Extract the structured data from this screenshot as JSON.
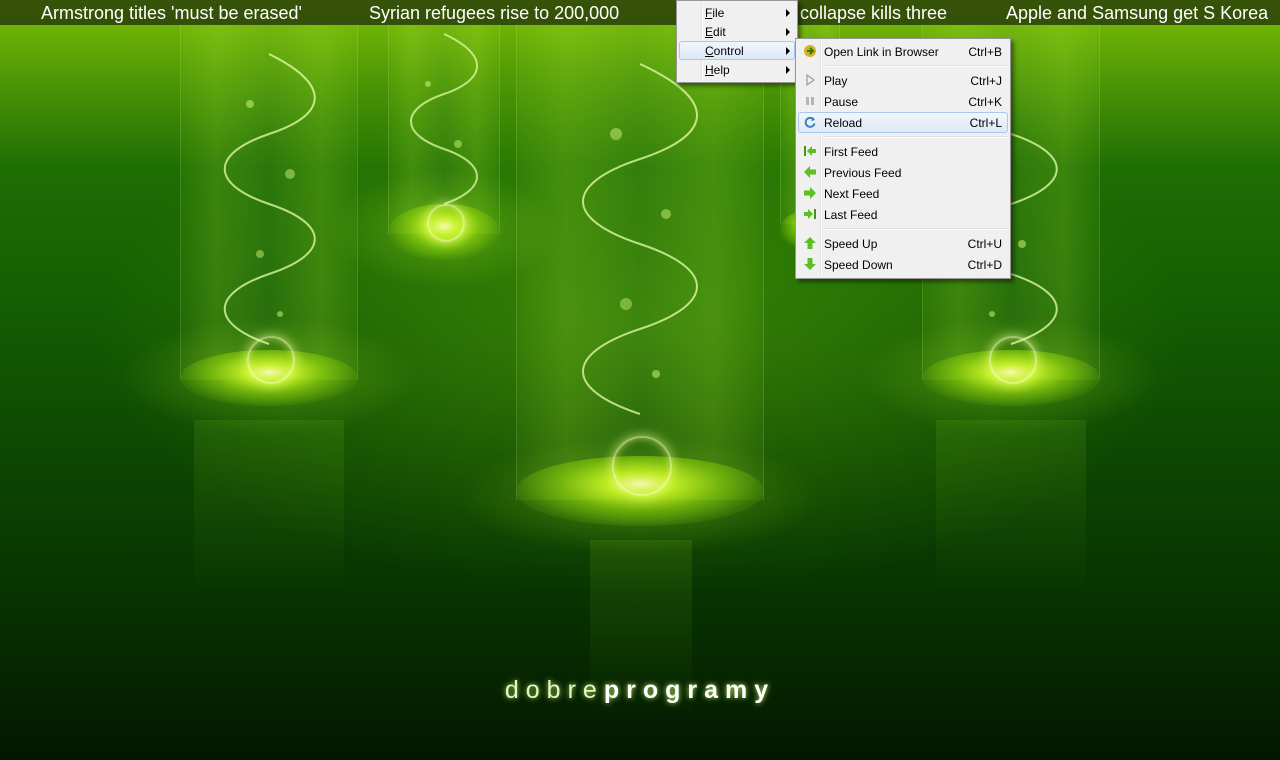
{
  "ticker": {
    "items": [
      "Armstrong titles 'must be erased'",
      "Syrian refugees rise to 200,000",
      "collapse kills three",
      "Apple and Samsung get S Korea"
    ]
  },
  "menu": {
    "items": [
      {
        "label": "File",
        "mnemonic": "F"
      },
      {
        "label": "Edit",
        "mnemonic": "E"
      },
      {
        "label": "Control",
        "mnemonic": "C",
        "selected": true
      },
      {
        "label": "Help",
        "mnemonic": "H"
      }
    ]
  },
  "control_submenu": {
    "items": [
      {
        "label": "Open Link in Browser",
        "shortcut": "Ctrl+B",
        "icon": "open-link-icon"
      },
      {
        "label": "Play",
        "shortcut": "Ctrl+J",
        "icon": "play-icon"
      },
      {
        "label": "Pause",
        "shortcut": "Ctrl+K",
        "icon": "pause-icon"
      },
      {
        "label": "Reload",
        "shortcut": "Ctrl+L",
        "icon": "reload-icon",
        "highlighted": true
      },
      {
        "label": "First Feed",
        "shortcut": "",
        "icon": "first-feed-icon"
      },
      {
        "label": "Previous Feed",
        "shortcut": "",
        "icon": "previous-feed-icon"
      },
      {
        "label": "Next Feed",
        "shortcut": "",
        "icon": "next-feed-icon"
      },
      {
        "label": "Last Feed",
        "shortcut": "",
        "icon": "last-feed-icon"
      },
      {
        "label": "Speed Up",
        "shortcut": "Ctrl+U",
        "icon": "speed-up-icon"
      },
      {
        "label": "Speed Down",
        "shortcut": "Ctrl+D",
        "icon": "speed-down-icon"
      }
    ]
  },
  "wallpaper": {
    "brand_light": "dobre",
    "brand_bold": "programy"
  },
  "colors": {
    "menu_background": "#f0f0f0",
    "menu_highlight": "#dde9f7",
    "icon_green": "#4caf1a",
    "wallpaper_green": "#145e03"
  }
}
